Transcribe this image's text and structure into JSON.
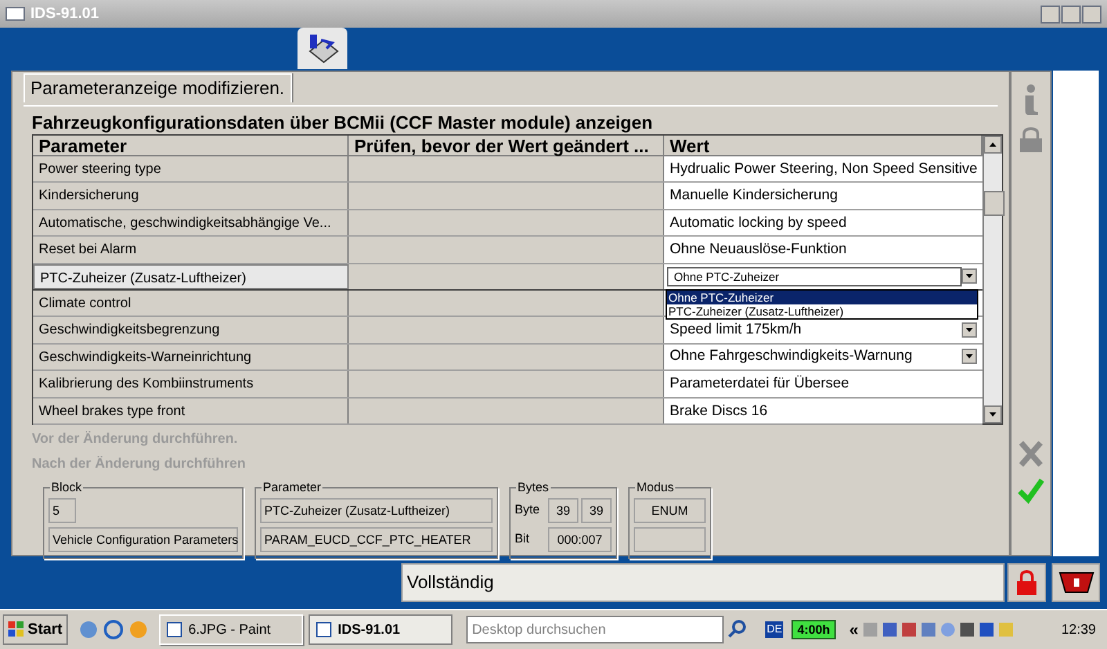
{
  "window": {
    "title": "IDS-91.01"
  },
  "tab": {
    "label": "Parameteranzeige modifizieren.",
    "selected": true
  },
  "section_title": "Fahrzeugkonfigurationsdaten über BCMii (CCF Master module) anzeigen",
  "table": {
    "columns": [
      "Parameter",
      "Prüfen, bevor der Wert geändert ...",
      "Wert"
    ],
    "rows": [
      {
        "parameter": "Power steering type",
        "value": "Hydrualic Power Steering, Non Speed Sensitive",
        "kind": "text",
        "selected": false
      },
      {
        "parameter": "Kindersicherung",
        "value": "Manuelle Kindersicherung",
        "kind": "text",
        "selected": false
      },
      {
        "parameter": "Automatische, geschwindigkeitsabhängige Ve...",
        "value": "Automatic locking by speed",
        "kind": "text",
        "selected": false
      },
      {
        "parameter": "Reset bei Alarm",
        "value": "Ohne Neuauslöse-Funktion",
        "kind": "text",
        "selected": false
      },
      {
        "parameter": "PTC-Zuheizer (Zusatz-Luftheizer)",
        "value": "Ohne PTC-Zuheizer",
        "kind": "open-combo",
        "selected": true,
        "options": [
          {
            "label": "Ohne PTC-Zuheizer",
            "selected": true
          },
          {
            "label": "PTC-Zuheizer (Zusatz-Luftheizer)",
            "selected": false
          }
        ]
      },
      {
        "parameter": "Climate control",
        "kind": "hidden",
        "selected": false
      },
      {
        "parameter": "Geschwindigkeitsbegrenzung",
        "value": "Speed limit 175km/h",
        "kind": "combo",
        "selected": false
      },
      {
        "parameter": "Geschwindigkeits-Warneinrichtung",
        "value": "Ohne Fahrgeschwindigkeits-Warnung",
        "kind": "combo",
        "selected": false
      },
      {
        "parameter": "Kalibrierung des Kombiinstruments",
        "value": "Parameterdatei für Übersee",
        "kind": "text",
        "selected": false
      },
      {
        "parameter": "Wheel brakes type front",
        "value": "Brake Discs 16",
        "kind": "text",
        "selected": false
      }
    ]
  },
  "steps": [
    {
      "label": "Vor der Änderung durchführen.",
      "disabled": true
    },
    {
      "label": "Nach der Änderung durchführen",
      "disabled": true
    }
  ],
  "block": {
    "title": "Block",
    "number": "5",
    "name": "Vehicle Configuration Parameters"
  },
  "parameter": {
    "title": "Parameter",
    "name": "PTC-Zuheizer (Zusatz-Luftheizer)",
    "id": "PARAM_EUCD_CCF_PTC_HEATER"
  },
  "bytes": {
    "title": "Bytes",
    "byte_label": "Byte",
    "byte_from": "39",
    "byte_to": "39",
    "bit_label": "Bit",
    "bit": "000:007"
  },
  "modus": {
    "title": "Modus",
    "value": "ENUM"
  },
  "status": "Vollständig",
  "taskbar": {
    "start": "Start",
    "tasks": [
      {
        "label": "6.JPG - Paint",
        "selected": false
      },
      {
        "label": "IDS-91.01",
        "selected": true
      }
    ],
    "search_placeholder": "Desktop durchsuchen",
    "language": "DE",
    "battery": "4:00h",
    "chevron": "«",
    "clock": "12:39"
  }
}
